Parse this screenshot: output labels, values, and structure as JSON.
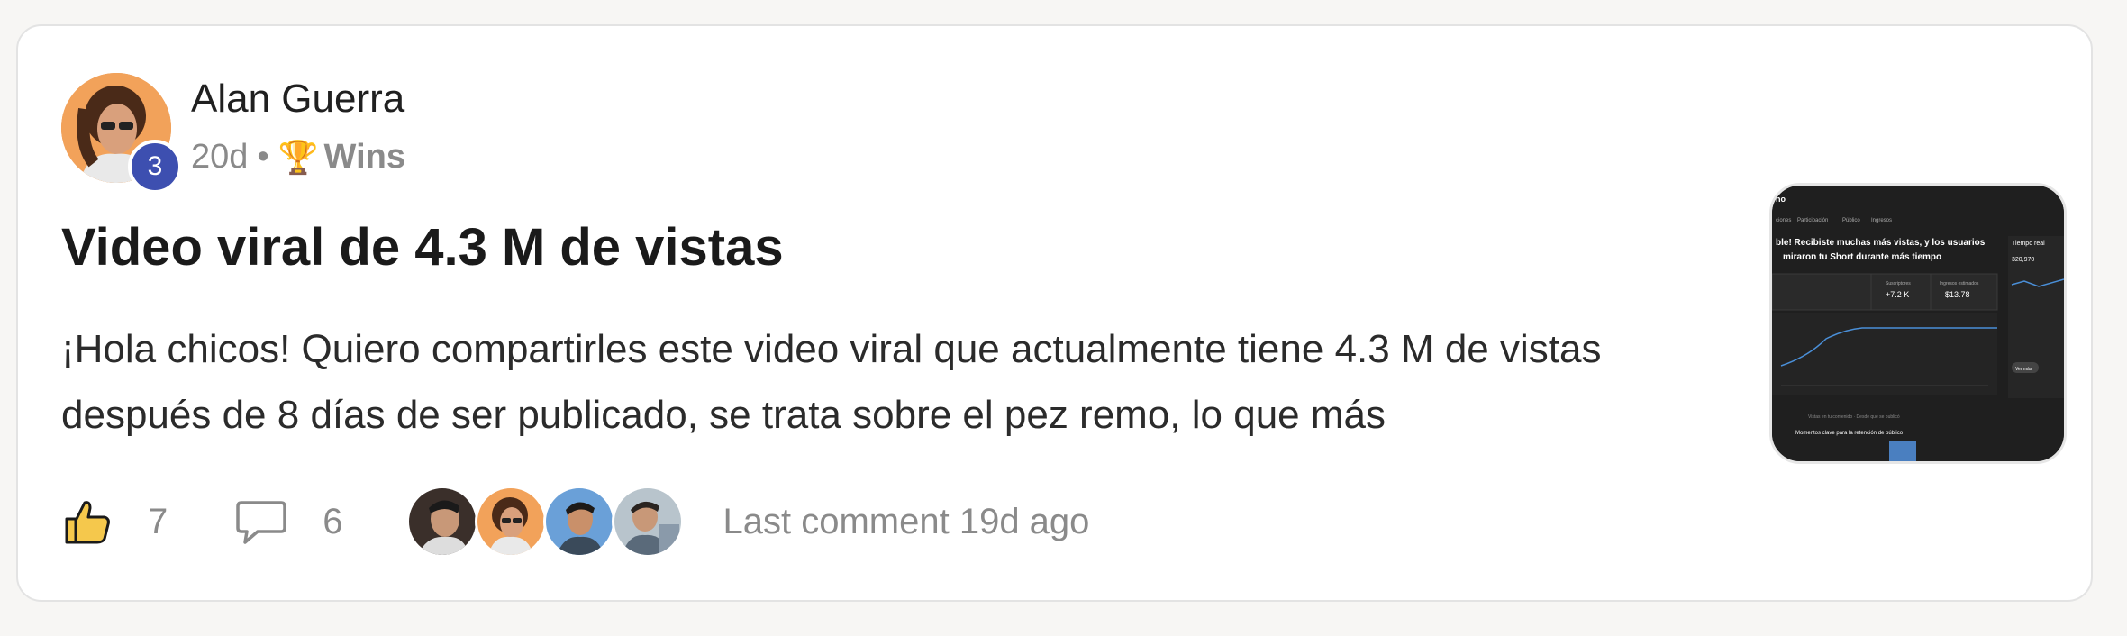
{
  "post": {
    "author": "Alan Guerra",
    "level": "3",
    "time_ago": "20d",
    "separator": "•",
    "category_icon": "trophy-icon",
    "category": "Wins",
    "title": "Video viral de 4.3 M de vistas",
    "body": "¡Hola chicos! Quiero compartirles este video viral que actualmente tiene 4.3 M de vistas después de 8 días de ser publicado, se trata sobre el pez remo, lo que más",
    "likes": "7",
    "comments": "6",
    "last_comment": "Last comment 19d ago"
  },
  "thumbnail": {
    "tabs": [
      "ciones",
      "Participación",
      "Público",
      "Ingresos"
    ],
    "headline": "ble! Recibiste muchas más vistas, y los usuarios miraron tu Short durante más tiempo",
    "stats": [
      {
        "label": "Suscriptores",
        "value": "+7.2 K"
      },
      {
        "label": "Ingresos estimados",
        "value": "$13.78"
      }
    ],
    "side_title": "Tiempo real",
    "side_value": "320,970",
    "button": "Ver más",
    "retention_title": "Momentos clave para la retención de público"
  },
  "colors": {
    "level_badge": "#3d4fb0",
    "thumb_bg": "#1f1f1f",
    "muted_text": "#8a8a8a",
    "like_fill": "#f5c84c"
  }
}
